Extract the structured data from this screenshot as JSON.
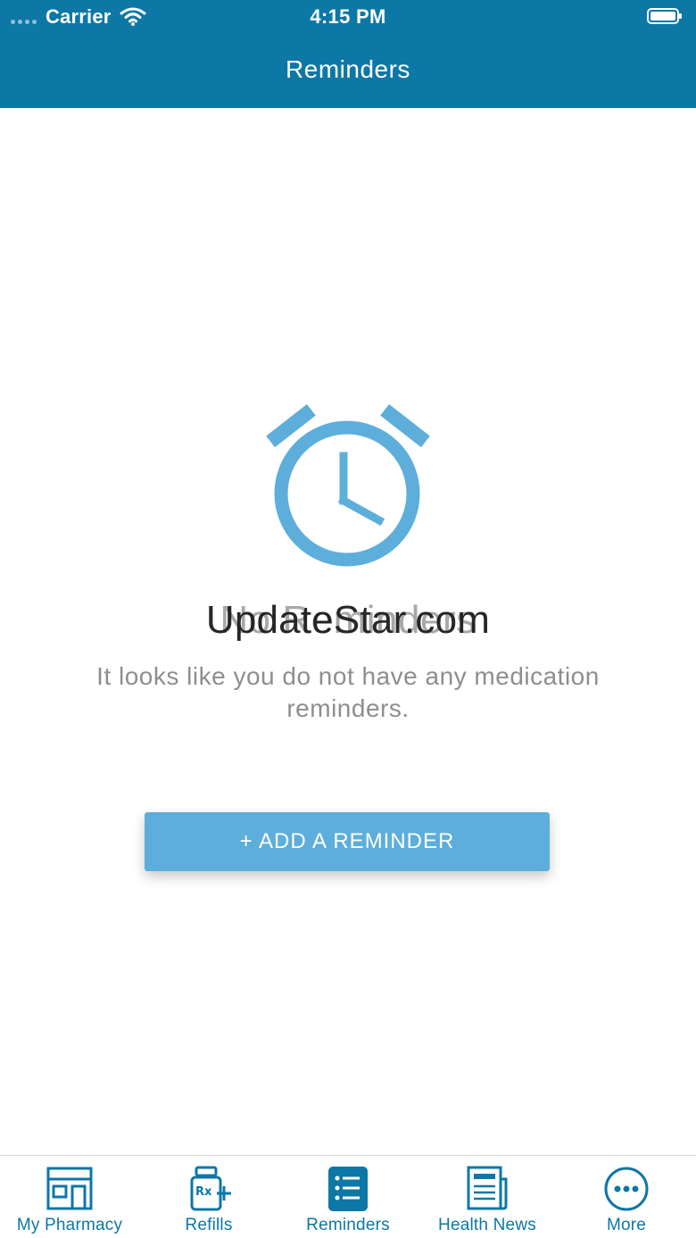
{
  "status_bar": {
    "carrier": "Carrier",
    "time": "4:15 PM"
  },
  "header": {
    "title": "Reminders"
  },
  "empty_state": {
    "title": "No Reminders",
    "subtitle": "It looks like you do not have any medication reminders.",
    "icon": "alarm-clock-icon"
  },
  "watermark": "UpdateStar.com",
  "add_button": {
    "label": "+ ADD A REMINDER"
  },
  "tab_bar": {
    "tabs": [
      {
        "label": "My Pharmacy",
        "icon": "store-icon"
      },
      {
        "label": "Refills",
        "icon": "rx-refill-icon"
      },
      {
        "label": "Reminders",
        "icon": "list-icon",
        "active": true
      },
      {
        "label": "Health News",
        "icon": "newspaper-icon"
      },
      {
        "label": "More",
        "icon": "more-icon"
      }
    ]
  },
  "colors": {
    "header": "#0d77a6",
    "accent": "#5daedb",
    "tab_label": "#0d77a6"
  }
}
